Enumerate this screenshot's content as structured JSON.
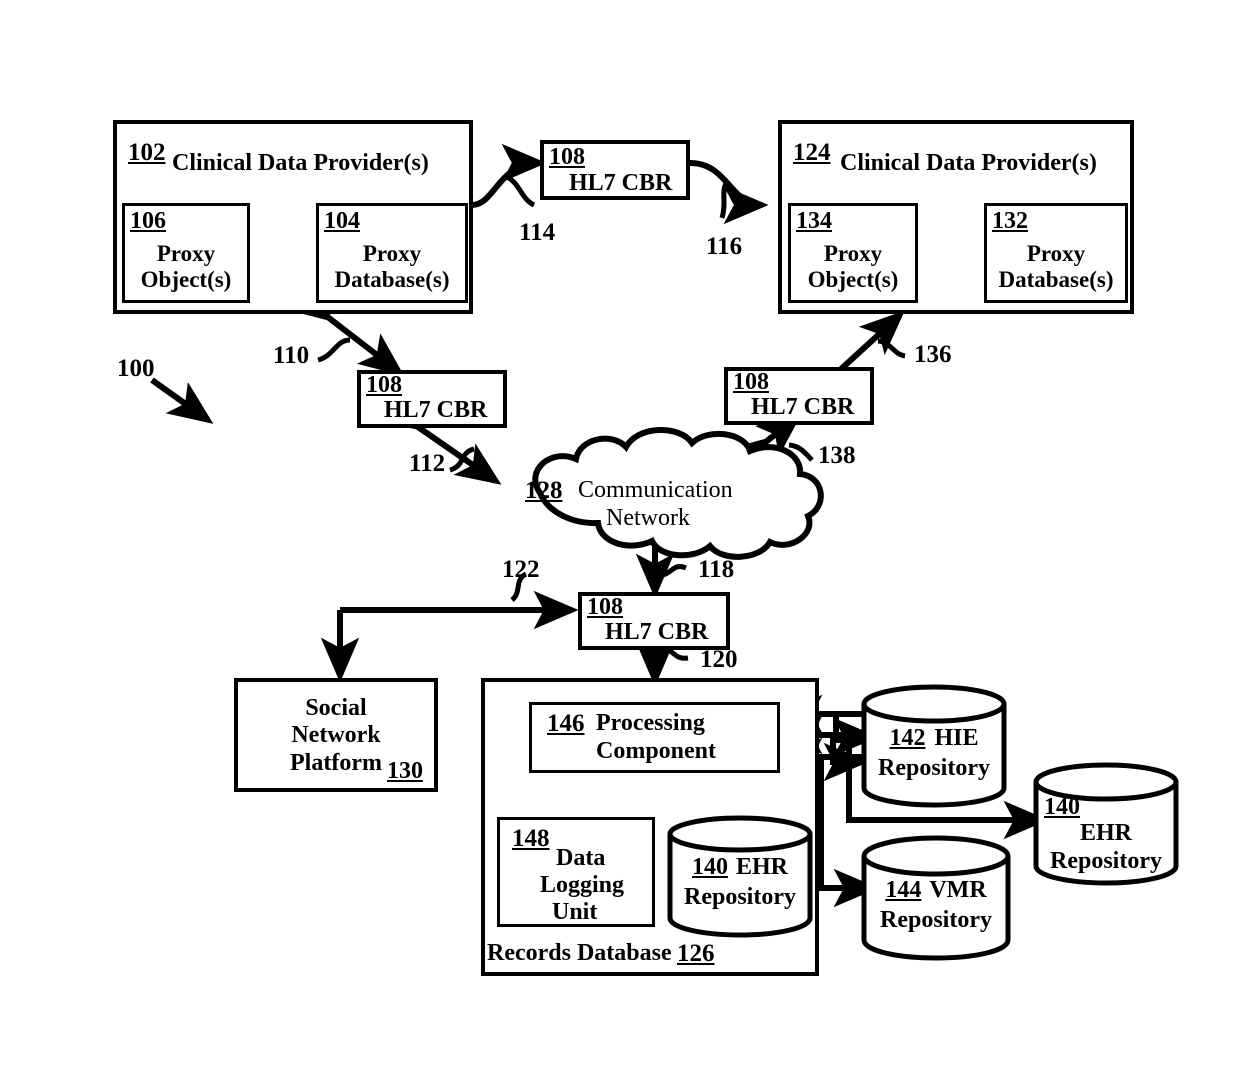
{
  "figure": {
    "system_ref": "100",
    "blocks": {
      "provider_left": {
        "ref": "102",
        "label": "Clinical Data Provider(s)"
      },
      "provider_right": {
        "ref": "124",
        "label": "Clinical Data Provider(s)"
      },
      "proxy_object_left": {
        "ref": "106",
        "line1": "Proxy",
        "line2": "Object(s)"
      },
      "proxy_db_left": {
        "ref": "104",
        "line1": "Proxy",
        "line2": "Database(s)"
      },
      "proxy_object_right": {
        "ref": "134",
        "line1": "Proxy",
        "line2": "Object(s)"
      },
      "proxy_db_right": {
        "ref": "132",
        "line1": "Proxy",
        "line2": "Database(s)"
      },
      "hl7_top": {
        "ref": "108",
        "label": "HL7 CBR"
      },
      "hl7_left": {
        "ref": "108",
        "label": "HL7 CBR"
      },
      "hl7_right": {
        "ref": "108",
        "label": "HL7 CBR"
      },
      "hl7_bottom": {
        "ref": "108",
        "label": "HL7 CBR"
      },
      "network_cloud": {
        "ref": "128",
        "line1": "Communication",
        "line2": "Network"
      },
      "social_network": {
        "ref": "130",
        "line1": "Social",
        "line2": "Network",
        "line3": "Platform"
      },
      "records_database": {
        "ref": "126",
        "label": "Records Database"
      },
      "processing_component": {
        "ref": "146",
        "line1": "Processing",
        "line2": "Component"
      },
      "data_logging_unit": {
        "ref": "148",
        "line1": "Data",
        "line2": "Logging",
        "line3": "Unit"
      },
      "ehr_inner": {
        "ref": "140",
        "line1": "EHR",
        "line2": "Repository"
      },
      "hie_repository": {
        "ref": "142",
        "line1": "HIE",
        "line2": "Repository"
      },
      "vmr_repository": {
        "ref": "144",
        "line1": "VMR",
        "line2": "Repository"
      },
      "ehr_outer": {
        "ref": "140",
        "line1": "EHR",
        "line2": "Repository"
      }
    },
    "connector_refs": {
      "c110": "110",
      "c112": "112",
      "c114": "114",
      "c116": "116",
      "c118": "118",
      "c120": "120",
      "c122": "122",
      "c136": "136",
      "c138": "138"
    },
    "colors": {
      "ink": "#000000",
      "paper": "#ffffff"
    }
  }
}
